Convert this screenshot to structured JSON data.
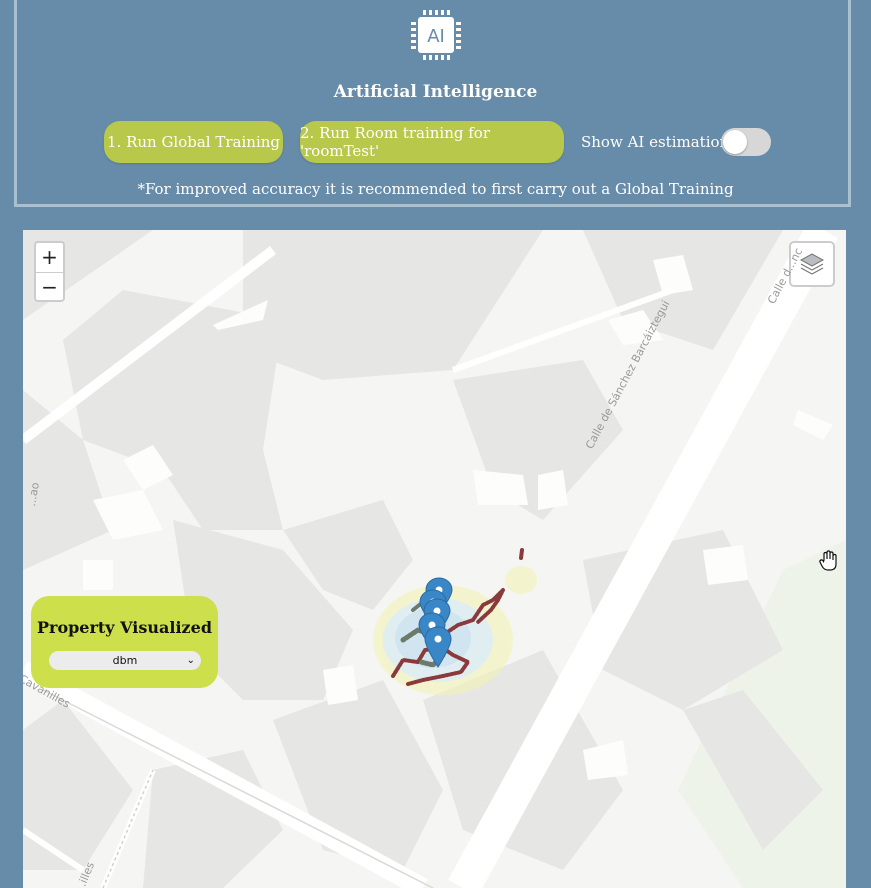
{
  "ai_panel": {
    "icon_text": "AI",
    "title": "Artificial Intelligence",
    "buttons": {
      "global": "1. Run Global Training",
      "room": "2. Run Room training for 'roomTest'"
    },
    "toggle": {
      "label": "Show AI estimations",
      "state": false
    },
    "note": "*For improved accuracy it is recommended to first carry out a Global Training"
  },
  "map": {
    "zoom_in": "+",
    "zoom_out": "−",
    "streets": {
      "sanchez": "Calle de Sánchez Barcáiztegui",
      "top_right": "Calle d...nc",
      "cavanilles": "Cavanilles",
      "cavanilles_bottom": "...illes",
      "left_edge": "...ao"
    },
    "property_panel": {
      "title": "Property Visualized",
      "selected": "dbm"
    },
    "colors": {
      "accent_button": "#b8c84a",
      "property_panel": "#cddf4a",
      "marker": "#3a87c7",
      "track_red": "#8a3a3a",
      "track_gray": "#6b7a6b"
    }
  }
}
